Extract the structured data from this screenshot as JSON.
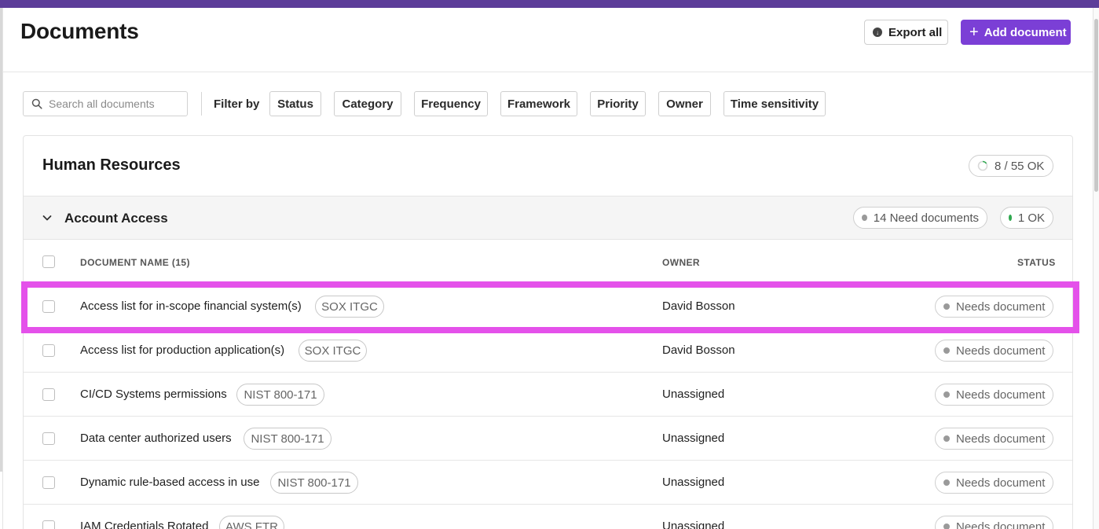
{
  "colors": {
    "accent": "#7b3fd6",
    "topbar": "#5c3d99",
    "highlight": "#e451ea",
    "ok_dot": "#2fa84f",
    "need_dot": "#9a9a9a"
  },
  "header": {
    "title": "Documents",
    "export_label": "Export all",
    "export_icon": "download-circle-icon",
    "add_label": "Add document",
    "add_icon": "plus-icon"
  },
  "search": {
    "placeholder": "Search all documents",
    "icon": "search-icon"
  },
  "filters": {
    "label": "Filter by",
    "chips": [
      "Status",
      "Category",
      "Frequency",
      "Framework",
      "Priority",
      "Owner",
      "Time sensitivity"
    ]
  },
  "section": {
    "title": "Human Resources",
    "summary": "8 / 55 OK",
    "summary_icon": "progress-ring-icon"
  },
  "group": {
    "title": "Account Access",
    "need_count": "14 Need documents",
    "ok_count": "1 OK",
    "chevron_icon": "chevron-down-icon"
  },
  "table": {
    "columns": {
      "name": "Document name (15)",
      "owner": "Owner",
      "status": "Status"
    },
    "rows": [
      {
        "name": "Access list for in-scope financial system(s)",
        "tag": "SOX ITGC",
        "owner": "David Bosson",
        "status": "Needs document"
      },
      {
        "name": "Access list for production application(s)",
        "tag": "SOX ITGC",
        "owner": "David Bosson",
        "status": "Needs document"
      },
      {
        "name": "CI/CD Systems permissions",
        "tag": "NIST 800-171",
        "owner": "Unassigned",
        "status": "Needs document"
      },
      {
        "name": "Data center authorized users",
        "tag": "NIST 800-171",
        "owner": "Unassigned",
        "status": "Needs document"
      },
      {
        "name": "Dynamic rule-based access in use",
        "tag": "NIST 800-171",
        "owner": "Unassigned",
        "status": "Needs document"
      },
      {
        "name": "IAM Credentials Rotated",
        "tag": "AWS FTR",
        "owner": "Unassigned",
        "status": "Needs document"
      }
    ]
  }
}
